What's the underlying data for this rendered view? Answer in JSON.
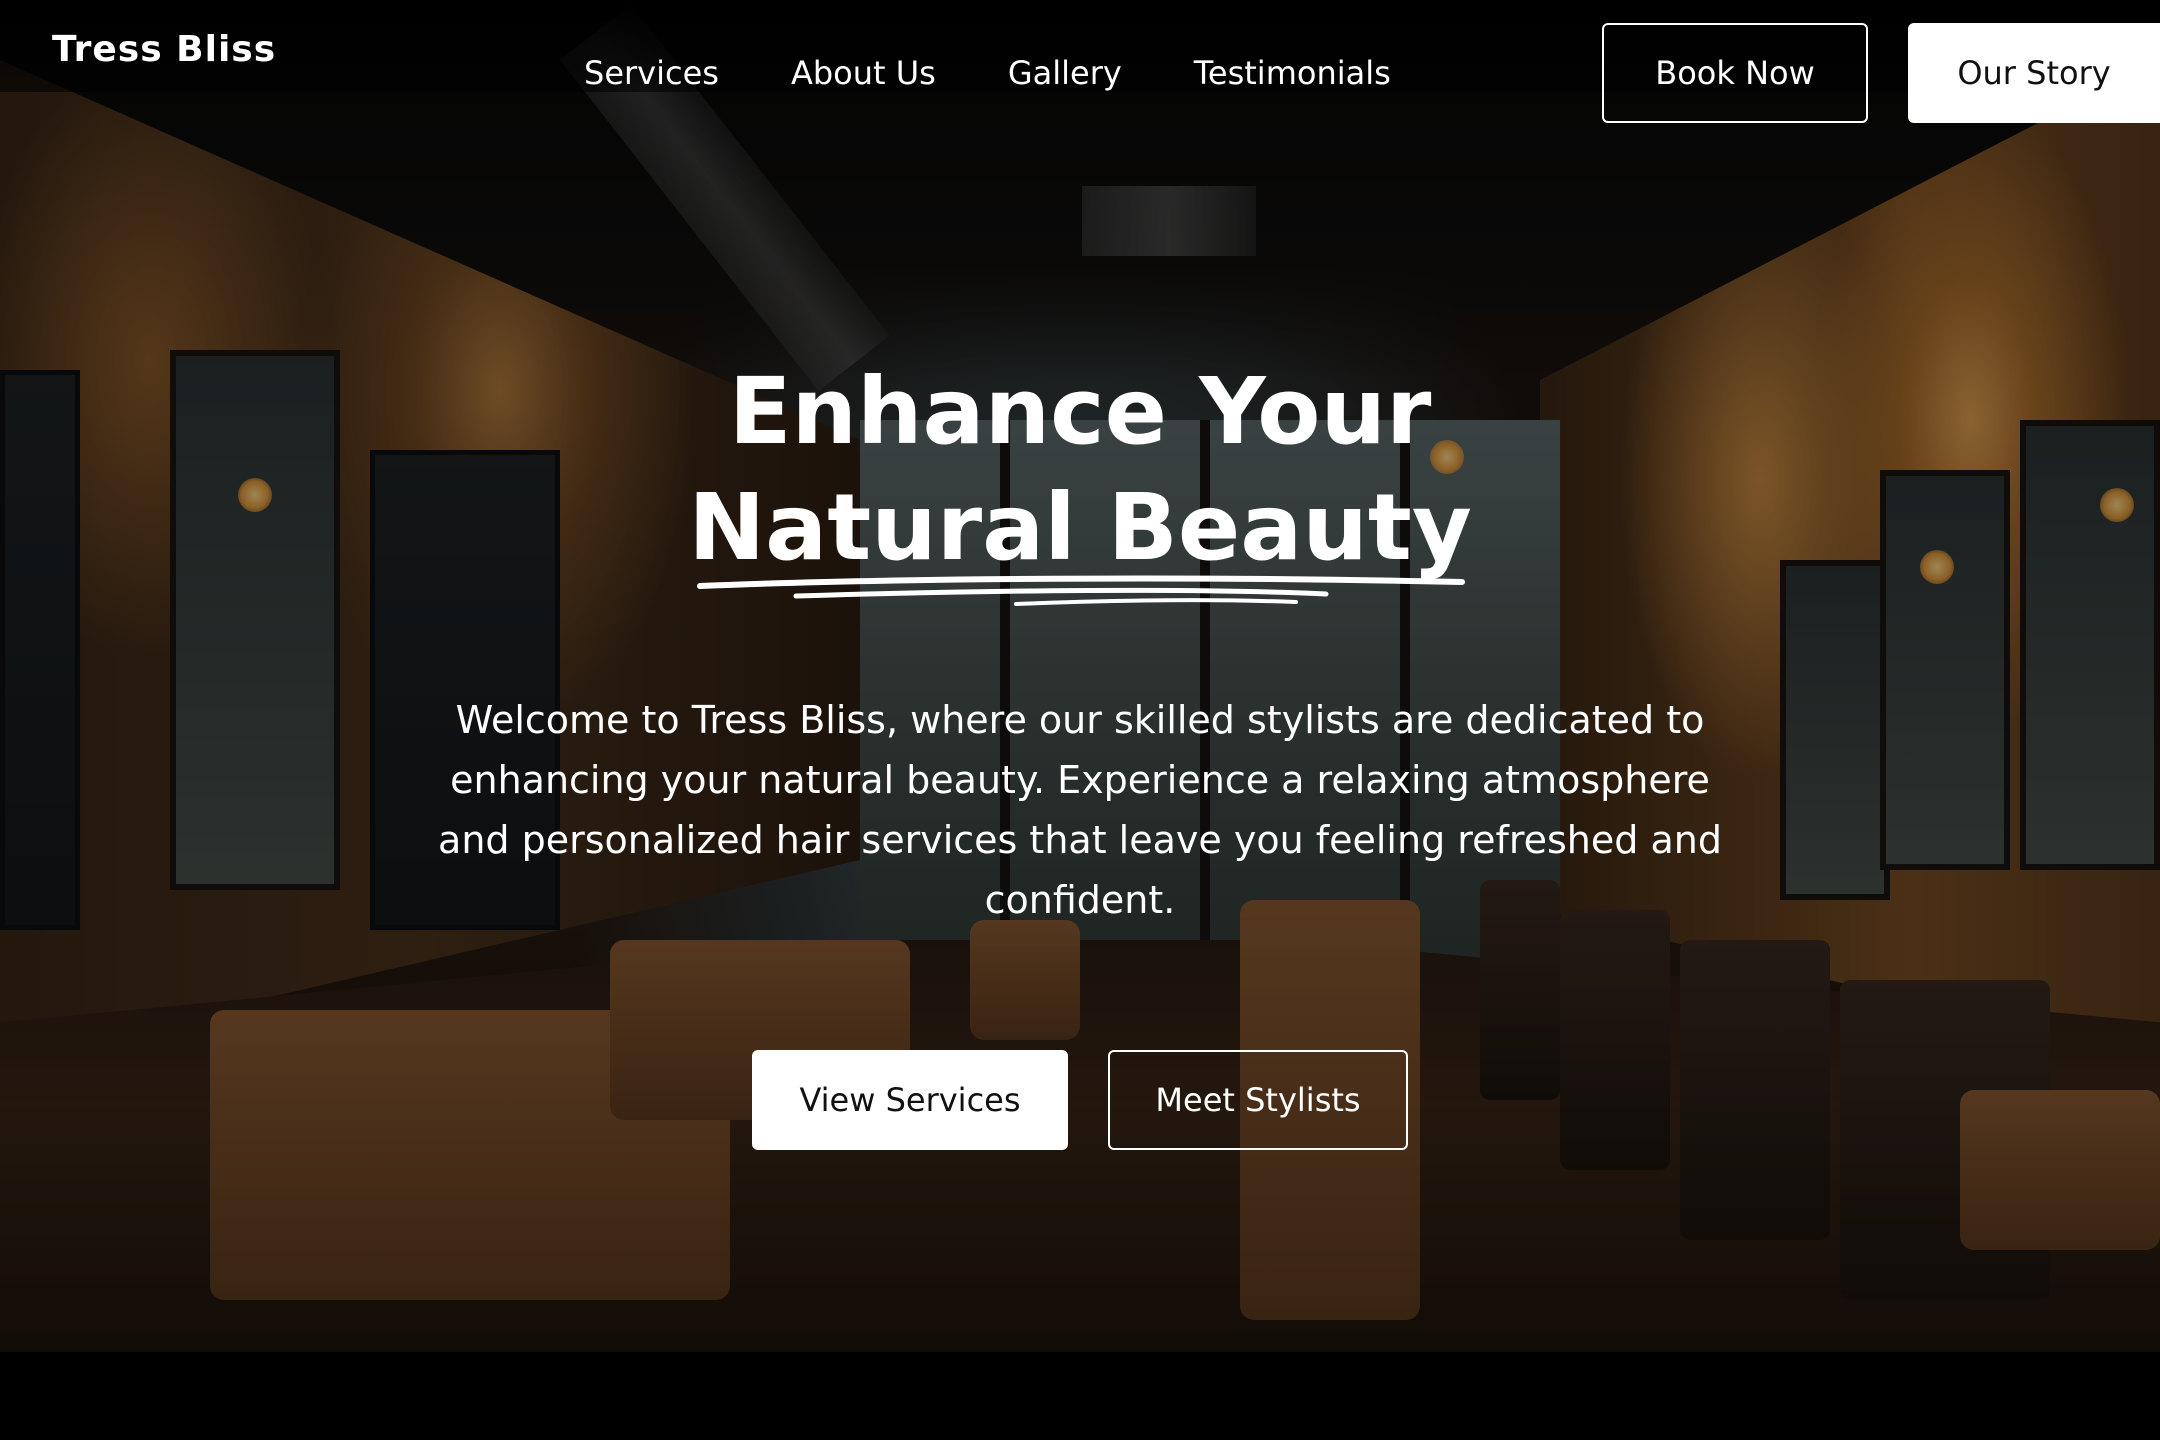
{
  "brand": {
    "name": "Tress Bliss"
  },
  "nav": {
    "links": [
      {
        "label": "Services"
      },
      {
        "label": "About Us"
      },
      {
        "label": "Gallery"
      },
      {
        "label": "Testimonials"
      }
    ],
    "book_label": "Book Now",
    "story_label": "Our Story"
  },
  "hero": {
    "headline_line1": "Enhance Your",
    "headline_line2": "Natural Beauty",
    "intro": "Welcome to Tress Bliss, where our skilled stylists are dedicated to enhancing your natural beauty. Experience a relaxing atmosphere and personalized hair services that leave you feeling refreshed and confident.",
    "primary_cta": "View Services",
    "secondary_cta": "Meet Stylists"
  },
  "colors": {
    "text": "#ffffff",
    "primary_button_bg": "#ffffff",
    "primary_button_text": "#111111",
    "background": "#000000"
  }
}
